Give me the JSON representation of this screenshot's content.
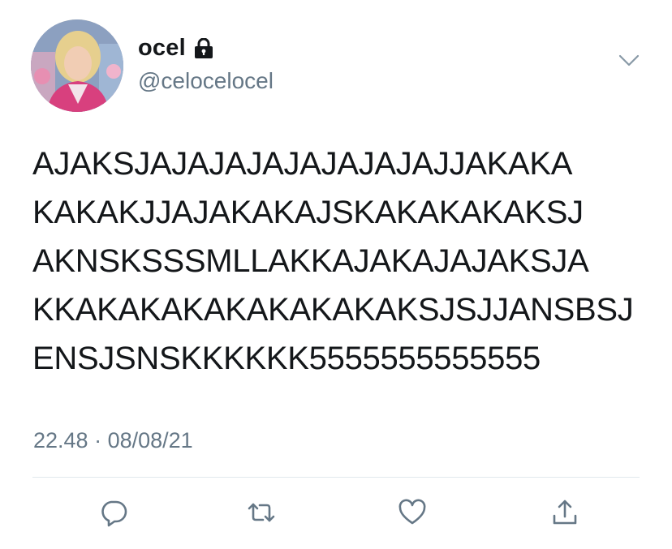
{
  "tweet": {
    "user": {
      "display_name": "ocel",
      "handle": "@celocelocel",
      "protected_icon": "lock-icon"
    },
    "text_lines": [
      "AJAKSJAJAJAJAJAJAJAJAJJAKAKA",
      "KAKAKJJAJAKAKAJSKAKAKAKAKSJ",
      "AKNSKSSSMLLAKKAJAKAJAJAKSJA",
      "KKAKAKAKAKAKAKAKAKSJSJJANSBSJ",
      "ENSJSNSKKKKKK5555555555555"
    ],
    "time": "22.48",
    "separator": " · ",
    "date": "08/08/21"
  },
  "actions": [
    "reply-icon",
    "retweet-icon",
    "like-icon",
    "share-icon"
  ],
  "colors": {
    "text": "#14171a",
    "secondary": "#657786",
    "divider": "#e1e8ed",
    "icon": "#657786"
  }
}
